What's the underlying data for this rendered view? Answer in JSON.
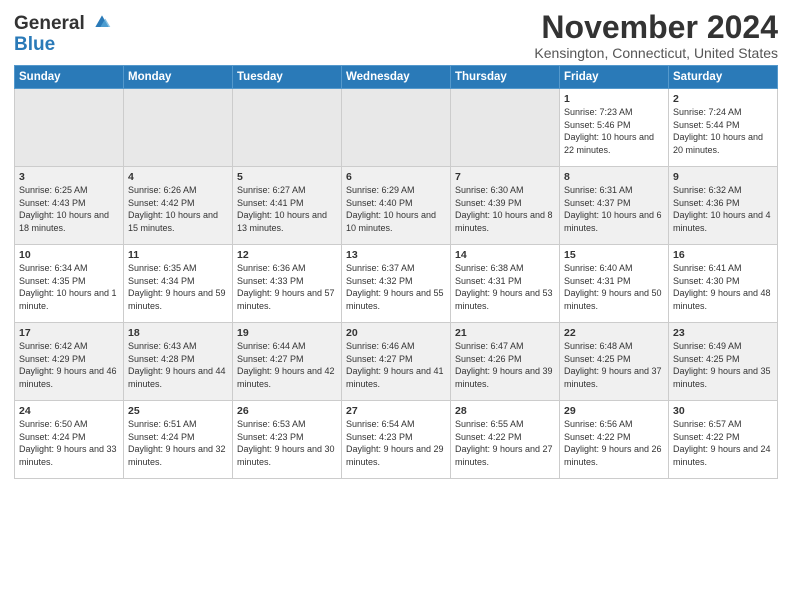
{
  "logo": {
    "line1": "General",
    "line2": "Blue"
  },
  "title": "November 2024",
  "location": "Kensington, Connecticut, United States",
  "weekdays": [
    "Sunday",
    "Monday",
    "Tuesday",
    "Wednesday",
    "Thursday",
    "Friday",
    "Saturday"
  ],
  "weeks": [
    [
      {
        "day": "",
        "info": ""
      },
      {
        "day": "",
        "info": ""
      },
      {
        "day": "",
        "info": ""
      },
      {
        "day": "",
        "info": ""
      },
      {
        "day": "",
        "info": ""
      },
      {
        "day": "1",
        "info": "Sunrise: 7:23 AM\nSunset: 5:46 PM\nDaylight: 10 hours and 22 minutes."
      },
      {
        "day": "2",
        "info": "Sunrise: 7:24 AM\nSunset: 5:44 PM\nDaylight: 10 hours and 20 minutes."
      }
    ],
    [
      {
        "day": "3",
        "info": "Sunrise: 6:25 AM\nSunset: 4:43 PM\nDaylight: 10 hours and 18 minutes."
      },
      {
        "day": "4",
        "info": "Sunrise: 6:26 AM\nSunset: 4:42 PM\nDaylight: 10 hours and 15 minutes."
      },
      {
        "day": "5",
        "info": "Sunrise: 6:27 AM\nSunset: 4:41 PM\nDaylight: 10 hours and 13 minutes."
      },
      {
        "day": "6",
        "info": "Sunrise: 6:29 AM\nSunset: 4:40 PM\nDaylight: 10 hours and 10 minutes."
      },
      {
        "day": "7",
        "info": "Sunrise: 6:30 AM\nSunset: 4:39 PM\nDaylight: 10 hours and 8 minutes."
      },
      {
        "day": "8",
        "info": "Sunrise: 6:31 AM\nSunset: 4:37 PM\nDaylight: 10 hours and 6 minutes."
      },
      {
        "day": "9",
        "info": "Sunrise: 6:32 AM\nSunset: 4:36 PM\nDaylight: 10 hours and 4 minutes."
      }
    ],
    [
      {
        "day": "10",
        "info": "Sunrise: 6:34 AM\nSunset: 4:35 PM\nDaylight: 10 hours and 1 minute."
      },
      {
        "day": "11",
        "info": "Sunrise: 6:35 AM\nSunset: 4:34 PM\nDaylight: 9 hours and 59 minutes."
      },
      {
        "day": "12",
        "info": "Sunrise: 6:36 AM\nSunset: 4:33 PM\nDaylight: 9 hours and 57 minutes."
      },
      {
        "day": "13",
        "info": "Sunrise: 6:37 AM\nSunset: 4:32 PM\nDaylight: 9 hours and 55 minutes."
      },
      {
        "day": "14",
        "info": "Sunrise: 6:38 AM\nSunset: 4:31 PM\nDaylight: 9 hours and 53 minutes."
      },
      {
        "day": "15",
        "info": "Sunrise: 6:40 AM\nSunset: 4:31 PM\nDaylight: 9 hours and 50 minutes."
      },
      {
        "day": "16",
        "info": "Sunrise: 6:41 AM\nSunset: 4:30 PM\nDaylight: 9 hours and 48 minutes."
      }
    ],
    [
      {
        "day": "17",
        "info": "Sunrise: 6:42 AM\nSunset: 4:29 PM\nDaylight: 9 hours and 46 minutes."
      },
      {
        "day": "18",
        "info": "Sunrise: 6:43 AM\nSunset: 4:28 PM\nDaylight: 9 hours and 44 minutes."
      },
      {
        "day": "19",
        "info": "Sunrise: 6:44 AM\nSunset: 4:27 PM\nDaylight: 9 hours and 42 minutes."
      },
      {
        "day": "20",
        "info": "Sunrise: 6:46 AM\nSunset: 4:27 PM\nDaylight: 9 hours and 41 minutes."
      },
      {
        "day": "21",
        "info": "Sunrise: 6:47 AM\nSunset: 4:26 PM\nDaylight: 9 hours and 39 minutes."
      },
      {
        "day": "22",
        "info": "Sunrise: 6:48 AM\nSunset: 4:25 PM\nDaylight: 9 hours and 37 minutes."
      },
      {
        "day": "23",
        "info": "Sunrise: 6:49 AM\nSunset: 4:25 PM\nDaylight: 9 hours and 35 minutes."
      }
    ],
    [
      {
        "day": "24",
        "info": "Sunrise: 6:50 AM\nSunset: 4:24 PM\nDaylight: 9 hours and 33 minutes."
      },
      {
        "day": "25",
        "info": "Sunrise: 6:51 AM\nSunset: 4:24 PM\nDaylight: 9 hours and 32 minutes."
      },
      {
        "day": "26",
        "info": "Sunrise: 6:53 AM\nSunset: 4:23 PM\nDaylight: 9 hours and 30 minutes."
      },
      {
        "day": "27",
        "info": "Sunrise: 6:54 AM\nSunset: 4:23 PM\nDaylight: 9 hours and 29 minutes."
      },
      {
        "day": "28",
        "info": "Sunrise: 6:55 AM\nSunset: 4:22 PM\nDaylight: 9 hours and 27 minutes."
      },
      {
        "day": "29",
        "info": "Sunrise: 6:56 AM\nSunset: 4:22 PM\nDaylight: 9 hours and 26 minutes."
      },
      {
        "day": "30",
        "info": "Sunrise: 6:57 AM\nSunset: 4:22 PM\nDaylight: 9 hours and 24 minutes."
      }
    ]
  ]
}
